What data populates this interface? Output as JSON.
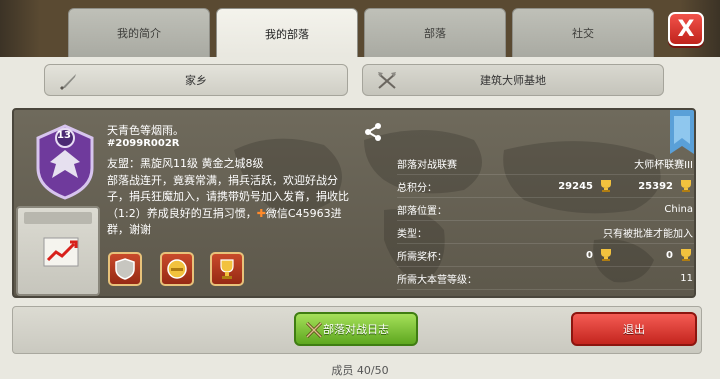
{
  "tabs": [
    {
      "label": "我的简介"
    },
    {
      "label": "我的部落"
    },
    {
      "label": "部落"
    },
    {
      "label": "社交"
    }
  ],
  "close_label": "X",
  "sub_tabs": {
    "home": "家乡",
    "builder": "建筑大师基地"
  },
  "clan": {
    "name": "天青色等烟雨。",
    "tag": "#2099R002R",
    "level_badge": "13",
    "desc_line1": "友盟：黑旋风11级  黄金之城8级",
    "desc_line2": "部落战连开，竟赛常满，捐兵活跃，欢迎好战分",
    "desc_line3": "子，捐兵狂魔加入，请携带奶号加入发育，捐收比",
    "desc_line4_a": "（1:2）养成良好的互捐习惯，",
    "desc_line4_b": "微信C45963进",
    "desc_line5": "群，谢谢"
  },
  "stats": {
    "war_league_label": "部落对战联赛",
    "war_league_value": "大师杯联赛III",
    "total_points_label": "总积分：",
    "total_points_1": "29245",
    "total_points_2": "25392",
    "location_label": "部落位置：",
    "location_value": "China",
    "type_label": "类型：",
    "type_value": "只有被批准才能加入",
    "required_trophies_label": "所需奖杯：",
    "required_trophies_1": "0",
    "required_trophies_2": "0",
    "required_th_label": "所需大本营等级：",
    "required_th_value": "11"
  },
  "buttons": {
    "war_log": "部落对战日志",
    "leave": "退出"
  },
  "members": "成员 40/50",
  "colors": {
    "accent_green": "#5ea71f",
    "accent_red": "#c4251e",
    "orange_text": "#ff8a2a"
  }
}
